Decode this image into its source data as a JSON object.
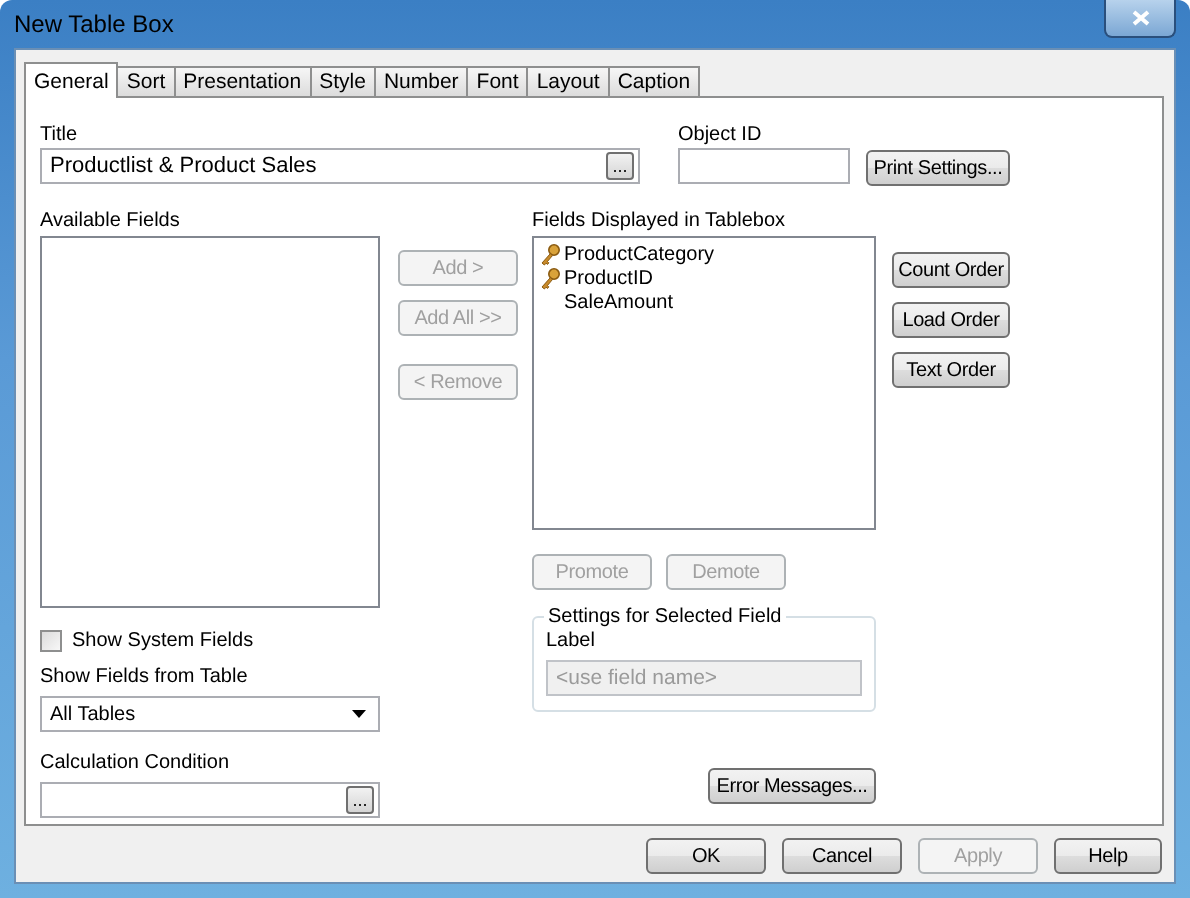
{
  "window": {
    "title": "New Table Box"
  },
  "tabs": [
    {
      "label": "General",
      "selected": true
    },
    {
      "label": "Sort",
      "selected": false
    },
    {
      "label": "Presentation",
      "selected": false
    },
    {
      "label": "Style",
      "selected": false
    },
    {
      "label": "Number",
      "selected": false
    },
    {
      "label": "Font",
      "selected": false
    },
    {
      "label": "Layout",
      "selected": false
    },
    {
      "label": "Caption",
      "selected": false
    }
  ],
  "title_field": {
    "label": "Title",
    "value": "Productlist & Product Sales",
    "browse": "..."
  },
  "object_id": {
    "label": "Object ID"
  },
  "print_settings": {
    "label": "Print Settings...",
    "disabled": false
  },
  "available_fields": {
    "label": "Available Fields"
  },
  "move_buttons": [
    {
      "label": "Add >",
      "disabled": true
    },
    {
      "label": "Add All >>",
      "disabled": true
    },
    {
      "label": "< Remove",
      "disabled": true
    }
  ],
  "displayed_fields": {
    "label": "Fields Displayed in Tablebox",
    "items": [
      {
        "name": "ProductCategory",
        "key": true
      },
      {
        "name": "ProductID",
        "key": true
      },
      {
        "name": "SaleAmount",
        "key": false
      }
    ]
  },
  "order_buttons": [
    {
      "label": "Count Order",
      "disabled": false
    },
    {
      "label": "Load Order",
      "disabled": false
    },
    {
      "label": "Text Order",
      "disabled": false
    }
  ],
  "show_system_fields": {
    "label": "Show System Fields",
    "checked": false
  },
  "show_fields_from_table": {
    "label": "Show Fields from Table",
    "value": "All Tables"
  },
  "calculation_condition": {
    "label": "Calculation Condition",
    "browse": "..."
  },
  "promote_buttons": [
    {
      "label": "Promote",
      "disabled": true
    },
    {
      "label": "Demote",
      "disabled": true
    }
  ],
  "settings_group": {
    "title": "Settings for Selected Field",
    "label": "Label",
    "placeholder": "<use field name>",
    "disabled": true
  },
  "error_messages": {
    "label": "Error Messages...",
    "disabled": false
  },
  "dialog_buttons": [
    {
      "label": "OK",
      "disabled": false
    },
    {
      "label": "Cancel",
      "disabled": false
    },
    {
      "label": "Apply",
      "disabled": true
    },
    {
      "label": "Help",
      "disabled": false
    }
  ]
}
